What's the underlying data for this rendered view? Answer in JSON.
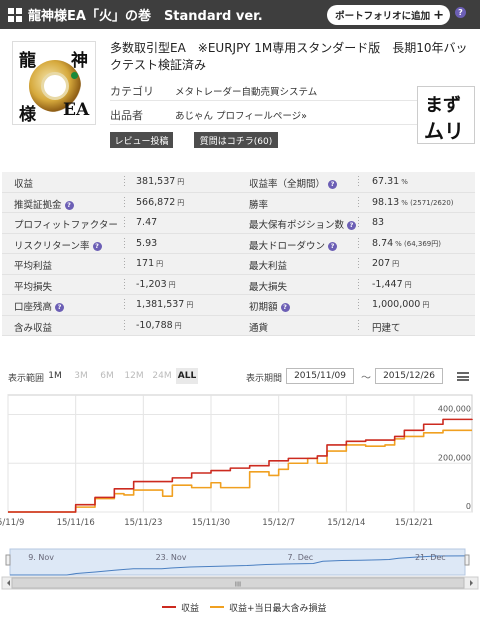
{
  "header": {
    "title": "龍神様EA「火」の巻　Standard ver.",
    "portfolio_button": "ポートフォリオに追加",
    "portfolio_plus": "+",
    "help": "?"
  },
  "product": {
    "thumb_chars": [
      "龍",
      "神",
      "様",
      "EA"
    ],
    "title": "多数取引型EA　※EURJPY 1M専用スタンダード版　長期10年バックテスト検証済み",
    "category_label": "カテゴリ",
    "category_value": "メタトレーダー自動売買システム",
    "seller_label": "出品者",
    "seller_value": "あじゃん プロフィールページ»",
    "review_button": "レビュー投稿",
    "question_button": "質問はコチラ(60)",
    "stamp_lines": [
      "まず",
      "ムリ"
    ]
  },
  "stats": {
    "rows": [
      {
        "l_label": "収益",
        "l_help": false,
        "l_value": "381,537",
        "l_unit": "円",
        "r_label": "収益率（全期間）",
        "r_help": true,
        "r_value": "67.31",
        "r_unit": "%"
      },
      {
        "l_label": "推奨証拠金",
        "l_help": true,
        "l_value": "566,872",
        "l_unit": "円",
        "r_label": "勝率",
        "r_help": false,
        "r_value": "98.13",
        "r_unit": "% (2571/2620)"
      },
      {
        "l_label": "プロフィットファクター",
        "l_help": false,
        "l_value": "7.47",
        "l_unit": "",
        "r_label": "最大保有ポジション数",
        "r_help": true,
        "r_value": "83",
        "r_unit": ""
      },
      {
        "l_label": "リスクリターン率",
        "l_help": true,
        "l_value": "5.93",
        "l_unit": "",
        "r_label": "最大ドローダウン",
        "r_help": true,
        "r_value": "8.74",
        "r_unit": "% (64,369円)"
      },
      {
        "l_label": "平均利益",
        "l_help": false,
        "l_value": "171",
        "l_unit": "円",
        "r_label": "最大利益",
        "r_help": false,
        "r_value": "207",
        "r_unit": "円"
      },
      {
        "l_label": "平均損失",
        "l_help": false,
        "l_value": "-1,203",
        "l_unit": "円",
        "r_label": "最大損失",
        "r_help": false,
        "r_value": "-1,447",
        "r_unit": "円"
      },
      {
        "l_label": "口座残高",
        "l_help": true,
        "l_value": "1,381,537",
        "l_unit": "円",
        "r_label": "初期額",
        "r_help": true,
        "r_value": "1,000,000",
        "r_unit": "円"
      },
      {
        "l_label": "含み収益",
        "l_help": false,
        "l_value": "-10,788",
        "l_unit": "円",
        "r_label": "通貨",
        "r_help": false,
        "r_value": "円建て",
        "r_unit": ""
      }
    ]
  },
  "range": {
    "label": "表示範囲",
    "buttons": [
      "1M",
      "3M",
      "6M",
      "12M",
      "24M",
      "ALL"
    ],
    "selected": "ALL",
    "period_label": "表示期間",
    "from": "2015/11/09",
    "tilde": "〜",
    "to": "2015/12/26"
  },
  "chart_data": {
    "type": "line",
    "x_ticks": [
      "15/11/9",
      "15/11/16",
      "15/11/23",
      "15/11/30",
      "15/12/7",
      "15/12/14",
      "15/12/21"
    ],
    "y_ticks": [
      "0",
      "200,000",
      "400,000"
    ],
    "ylim": [
      0,
      480000
    ],
    "x_range_days": [
      0,
      48
    ],
    "series": [
      {
        "name": "収益",
        "color": "#cc2a1f",
        "x": [
          0,
          6,
          7,
          9,
          11,
          13,
          16,
          17,
          19,
          21,
          23,
          25,
          27,
          29,
          32,
          33,
          35,
          37,
          40,
          41,
          43,
          45,
          48
        ],
        "y": [
          0,
          0,
          30000,
          60000,
          95000,
          125000,
          125000,
          140000,
          160000,
          170000,
          180000,
          190000,
          210000,
          220000,
          230000,
          275000,
          290000,
          295000,
          310000,
          335000,
          360000,
          380000,
          382000
        ]
      },
      {
        "name": "収益+当日最大含み損益",
        "color": "#f0a020",
        "x": [
          0,
          6,
          7,
          9,
          11,
          12,
          13,
          16,
          17,
          19,
          21,
          22,
          25,
          27,
          28,
          29,
          31,
          32,
          33,
          35,
          37,
          39,
          40,
          41,
          43,
          45,
          48
        ],
        "y": [
          0,
          0,
          20000,
          55000,
          75000,
          70000,
          90000,
          65000,
          110000,
          100000,
          120000,
          100000,
          165000,
          150000,
          175000,
          200000,
          220000,
          200000,
          250000,
          275000,
          270000,
          275000,
          300000,
          310000,
          325000,
          335000,
          335000
        ]
      }
    ],
    "navigator": {
      "labels": [
        "9. Nov",
        "23. Nov",
        "7. Dec",
        "21. Dec"
      ],
      "scroll_label": "III"
    }
  }
}
